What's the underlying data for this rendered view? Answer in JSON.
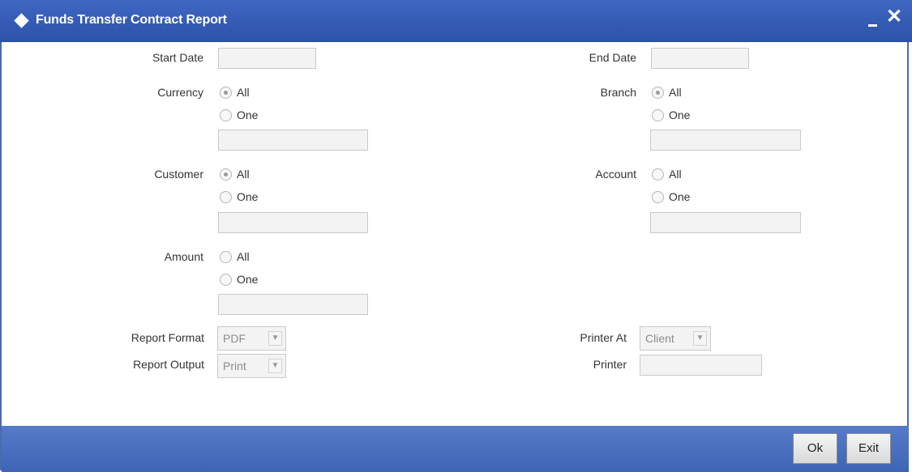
{
  "window": {
    "title": "Funds Transfer Contract Report",
    "minimize_icon": "minimize-icon",
    "close_icon": "close-icon",
    "close_glyph": "✕"
  },
  "fields": {
    "start_date": {
      "label": "Start Date",
      "value": ""
    },
    "end_date": {
      "label": "End Date",
      "value": ""
    }
  },
  "groups": {
    "currency": {
      "label": "Currency",
      "all": "All",
      "one": "One",
      "selected": "All",
      "value": ""
    },
    "branch": {
      "label": "Branch",
      "all": "All",
      "one": "One",
      "selected": "All",
      "value": ""
    },
    "customer": {
      "label": "Customer",
      "all": "All",
      "one": "One",
      "selected": "All",
      "value": ""
    },
    "account": {
      "label": "Account",
      "all": "All",
      "one": "One",
      "selected": "",
      "value": ""
    },
    "amount": {
      "label": "Amount",
      "all": "All",
      "one": "One",
      "selected": "",
      "value": ""
    }
  },
  "report": {
    "format_label": "Report Format",
    "format_value": "PDF",
    "output_label": "Report Output",
    "output_value": "Print",
    "printer_at_label": "Printer At",
    "printer_at_value": "Client",
    "printer_label": "Printer",
    "printer_value": ""
  },
  "footer": {
    "ok_label": "Ok",
    "exit_label": "Exit"
  },
  "colors": {
    "titlebar": "#2c52a9",
    "footer": "#4a6fc0"
  }
}
